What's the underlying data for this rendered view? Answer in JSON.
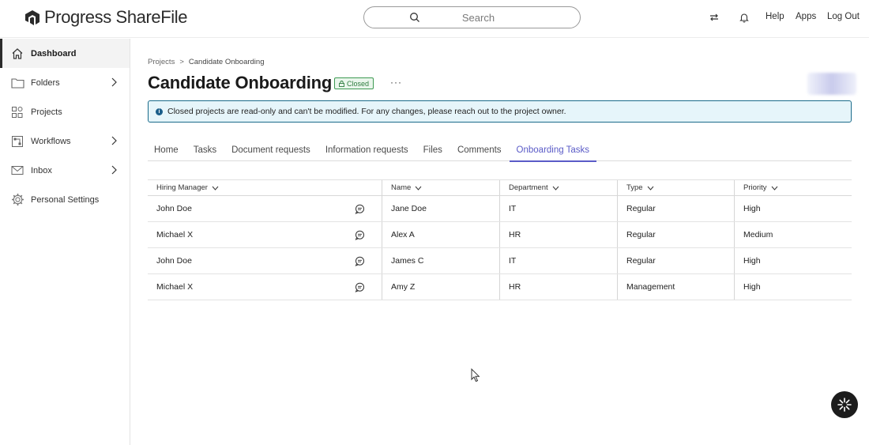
{
  "brand": {
    "logo_text": "Progress ShareFile"
  },
  "header": {
    "search_placeholder": "Search",
    "links": {
      "help": "Help",
      "apps": "Apps",
      "logout": "Log Out"
    },
    "icons": [
      "swap-icon",
      "bell-icon"
    ]
  },
  "sidebar": {
    "items": [
      {
        "label": "Dashboard",
        "icon": "home-icon",
        "active": true,
        "expandable": false
      },
      {
        "label": "Folders",
        "icon": "folder-icon",
        "active": false,
        "expandable": true
      },
      {
        "label": "Projects",
        "icon": "projects-icon",
        "active": false,
        "expandable": false
      },
      {
        "label": "Workflows",
        "icon": "workflow-icon",
        "active": false,
        "expandable": true
      },
      {
        "label": "Inbox",
        "icon": "mail-icon",
        "active": false,
        "expandable": true
      },
      {
        "label": "Personal Settings",
        "icon": "gear-icon",
        "active": false,
        "expandable": false
      }
    ]
  },
  "breadcrumb": {
    "parent": "Projects",
    "separator": ">",
    "current": "Candidate Onboarding"
  },
  "page": {
    "title": "Candidate Onboarding",
    "status_badge": "Closed",
    "more": "···"
  },
  "banner": {
    "text": "Closed projects are read-only and can't be modified. For any changes, please reach out to the project owner."
  },
  "tabs": [
    {
      "label": "Home",
      "active": false
    },
    {
      "label": "Tasks",
      "active": false
    },
    {
      "label": "Document requests",
      "active": false
    },
    {
      "label": "Information requests",
      "active": false
    },
    {
      "label": "Files",
      "active": false
    },
    {
      "label": "Comments",
      "active": false
    },
    {
      "label": "Onboarding Tasks",
      "active": true
    }
  ],
  "table": {
    "columns": [
      "Hiring Manager",
      "Name",
      "Department",
      "Type",
      "Priority"
    ],
    "rows": [
      [
        "John Doe",
        "Jane Doe",
        "IT",
        "Regular",
        "High"
      ],
      [
        "Michael X",
        "Alex A",
        "HR",
        "Regular",
        "Medium"
      ],
      [
        "John Doe",
        "James C",
        "IT",
        "Regular",
        "High"
      ],
      [
        "Michael X",
        "Amy Z",
        "HR",
        "Management",
        "High"
      ]
    ]
  },
  "colors": {
    "accent": "#5a5bc7",
    "banner_bg": "#e6f5fa",
    "banner_border": "#1a6b8a",
    "badge_green": "#2f7d40"
  }
}
